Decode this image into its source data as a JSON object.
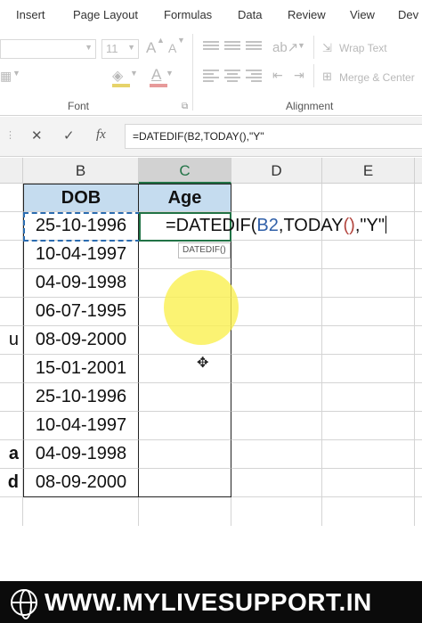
{
  "ribbon_tabs": [
    "Insert",
    "Page Layout",
    "Formulas",
    "Data",
    "Review",
    "View",
    "Dev"
  ],
  "ribbon": {
    "font_size": "11",
    "grow_font": "A",
    "shrink_font": "A",
    "font_color": "A",
    "wrap_text": "Wrap Text",
    "merge_center": "Merge & Center",
    "font_group": "Font",
    "alignment_group": "Alignment"
  },
  "formula_bar": {
    "cancel": "✕",
    "enter": "✓",
    "fx": "fx",
    "formula": "=DATEDIF(B2,TODAY(),\"Y\""
  },
  "columns": [
    "B",
    "C",
    "D",
    "E"
  ],
  "headers": {
    "dob": "DOB",
    "age": "Age"
  },
  "dob_values": [
    "25-10-1996",
    "10-04-1997",
    "04-09-1998",
    "06-07-1995",
    "08-09-2000",
    "15-01-2001",
    "25-10-1996",
    "10-04-1997",
    "04-09-1998",
    "08-09-2000"
  ],
  "name_fragments": [
    "",
    "",
    "",
    "",
    "u",
    "",
    "",
    "",
    "a",
    "d"
  ],
  "edit": {
    "prefix": "=DATEDIF(",
    "ref": "B2",
    "func": ",TODAY",
    "parens": "()",
    "suffix": ",\"Y\"",
    "tooltip": "DATEDIF()"
  },
  "banner": {
    "text": "WWW.MYLIVESUPPORT.IN"
  },
  "colors": {
    "header_fill": "#c5dcef",
    "excel_green": "#217346",
    "ref_blue": "#2f5fa8",
    "highlight": "#faf050"
  }
}
